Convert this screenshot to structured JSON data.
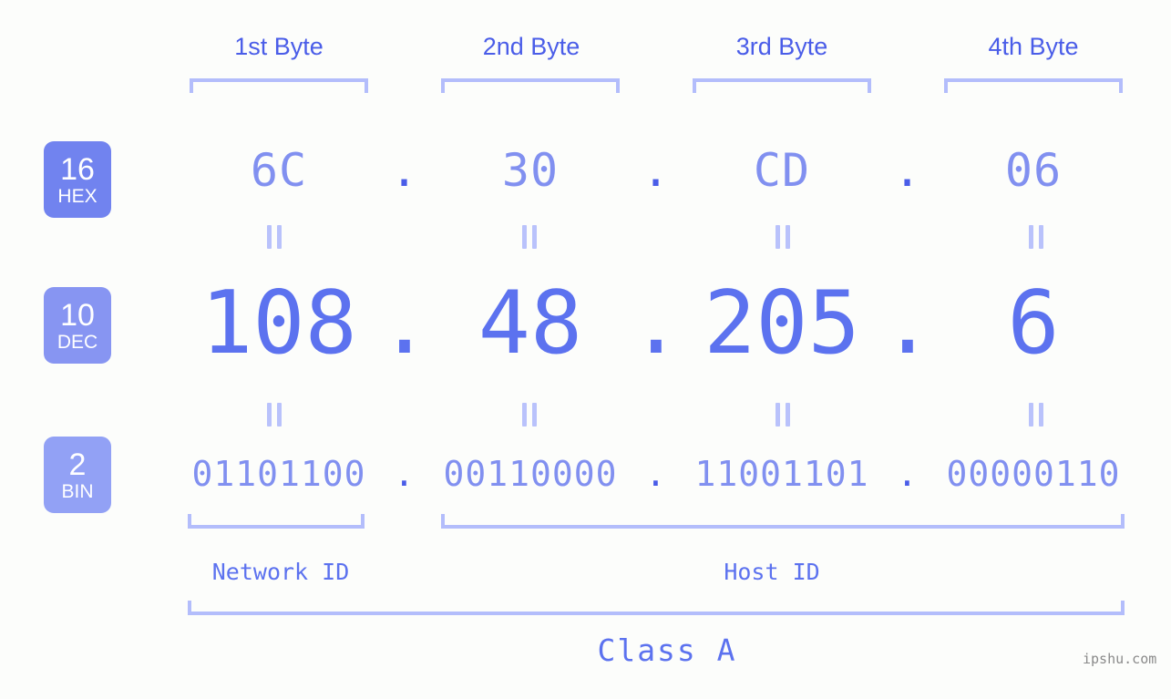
{
  "page": {
    "background_color": "#fcfdfb",
    "accent_color": "#5c72ef",
    "light_accent_color": "#b3bdfb",
    "watermark": "ipshu.com"
  },
  "byte_headers": [
    {
      "label": "1st Byte"
    },
    {
      "label": "2nd Byte"
    },
    {
      "label": "3rd Byte"
    },
    {
      "label": "4th Byte"
    }
  ],
  "rows": [
    {
      "id": "hex",
      "badge": {
        "number": "16",
        "name": "HEX",
        "color": "#7183ef"
      },
      "separator": ".",
      "values": [
        "6C",
        "30",
        "CD",
        "06"
      ]
    },
    {
      "id": "dec",
      "badge": {
        "number": "10",
        "name": "DEC",
        "color": "#8795f2"
      },
      "separator": ".",
      "values": [
        "108",
        "48",
        "205",
        "6"
      ]
    },
    {
      "id": "bin",
      "badge": {
        "number": "2",
        "name": "BIN",
        "color": "#92a1f5"
      },
      "separator": ".",
      "values": [
        "01101100",
        "00110000",
        "11001101",
        "00000110"
      ]
    }
  ],
  "equals_symbol": "=",
  "id_sections": [
    {
      "label": "Network ID"
    },
    {
      "label": "Host ID"
    }
  ],
  "class_label": "Class A"
}
